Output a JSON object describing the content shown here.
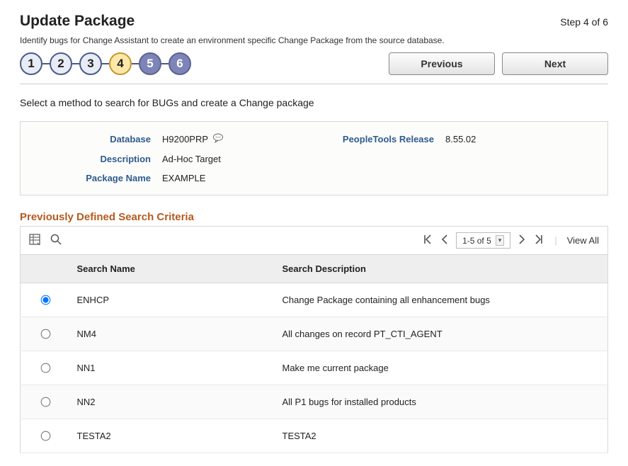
{
  "header": {
    "title": "Update Package",
    "step_text": "Step 4 of 6",
    "subtitle": "Identify bugs for Change Assistant to create an environment specific Change Package from the source database."
  },
  "wizard": {
    "steps": [
      "1",
      "2",
      "3",
      "4",
      "5",
      "6"
    ],
    "current_index": 3
  },
  "nav": {
    "previous": "Previous",
    "next": "Next"
  },
  "instruction": "Select a method to search for BUGs and create a Change package",
  "info": {
    "database_label": "Database",
    "database_value": "H9200PRP",
    "ptrelease_label": "PeopleTools Release",
    "ptrelease_value": "8.55.02",
    "description_label": "Description",
    "description_value": "Ad-Hoc Target",
    "pkgname_label": "Package Name",
    "pkgname_value": "EXAMPLE"
  },
  "criteria": {
    "heading": "Previously Defined Search Criteria",
    "page_range": "1-5 of 5",
    "view_all": "View All",
    "columns": {
      "name": "Search Name",
      "desc": "Search Description"
    },
    "rows": [
      {
        "selected": true,
        "name": "ENHCP",
        "desc": "Change Package containing all enhancement bugs"
      },
      {
        "selected": false,
        "name": "NM4",
        "desc": "All changes on record PT_CTI_AGENT"
      },
      {
        "selected": false,
        "name": "NN1",
        "desc": "Make me current package"
      },
      {
        "selected": false,
        "name": "NN2",
        "desc": "All P1 bugs for installed products"
      },
      {
        "selected": false,
        "name": "TESTA2",
        "desc": "TESTA2"
      }
    ]
  }
}
